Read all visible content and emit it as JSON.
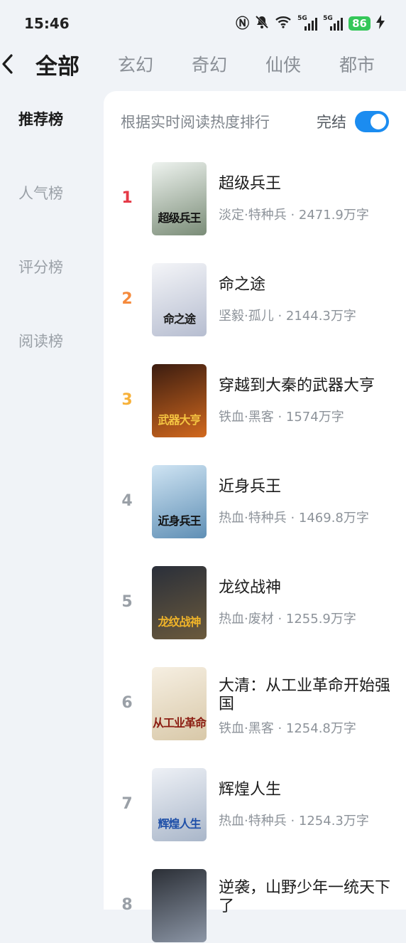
{
  "status": {
    "time": "15:46",
    "net_a": "5G",
    "net_b": "5G",
    "battery": "86"
  },
  "header": {
    "tabs": [
      {
        "label": "全部"
      },
      {
        "label": "玄幻"
      },
      {
        "label": "奇幻"
      },
      {
        "label": "仙侠"
      },
      {
        "label": "都市"
      }
    ]
  },
  "sidebar": {
    "items": [
      {
        "label": "推荐榜"
      },
      {
        "label": "人气榜"
      },
      {
        "label": "评分榜"
      },
      {
        "label": "阅读榜"
      }
    ]
  },
  "panel": {
    "hint": "根据实时阅读热度排行",
    "toggle_label": "完结",
    "toggle_on": true
  },
  "books": [
    {
      "rank": "1",
      "title": "超级兵王",
      "meta": "淡定·特种兵 · 2471.9万字",
      "cover_text": "超级兵王",
      "cover_colors": [
        "#eef3ef",
        "#7a8c77"
      ],
      "cover_ink": "#111111"
    },
    {
      "rank": "2",
      "title": "命之途",
      "meta": "坚毅·孤儿 · 2144.3万字",
      "cover_text": "命之途",
      "cover_colors": [
        "#f4f5f8",
        "#b6bdd0"
      ],
      "cover_ink": "#1a1a1a"
    },
    {
      "rank": "3",
      "title": "穿越到大秦的武器大亨",
      "meta": "铁血·黑客 · 1574万字",
      "cover_text": "武器大亨",
      "cover_colors": [
        "#3b1c10",
        "#d2691e"
      ],
      "cover_ink": "#f5c542"
    },
    {
      "rank": "4",
      "title": "近身兵王",
      "meta": "热血·特种兵 · 1469.8万字",
      "cover_text": "近身兵王",
      "cover_colors": [
        "#cfe4f3",
        "#5f8fb5"
      ],
      "cover_ink": "#111111"
    },
    {
      "rank": "5",
      "title": "龙纹战神",
      "meta": "热血·废材 · 1255.9万字",
      "cover_text": "龙纹战神",
      "cover_colors": [
        "#2a2f3a",
        "#6b5a3c"
      ],
      "cover_ink": "#f0b429"
    },
    {
      "rank": "6",
      "title": "大清：从工业革命开始强国",
      "meta": "铁血·黑客 · 1254.8万字",
      "cover_text": "从工业革命",
      "cover_colors": [
        "#f6efe2",
        "#d8c8a8"
      ],
      "cover_ink": "#8b1d12"
    },
    {
      "rank": "7",
      "title": "辉煌人生",
      "meta": "热血·特种兵 · 1254.3万字",
      "cover_text": "辉煌人生",
      "cover_colors": [
        "#eef1f6",
        "#a9b6c9"
      ],
      "cover_ink": "#1e4fa8"
    },
    {
      "rank": "8",
      "title": "逆袭，山野少年一统天下了",
      "meta": "",
      "cover_text": "",
      "cover_colors": [
        "#2b2f36",
        "#8c96a6"
      ],
      "cover_ink": "#ffffff"
    }
  ],
  "rank_colors": [
    "#e53946",
    "#f58a3c",
    "#f7b13a"
  ]
}
